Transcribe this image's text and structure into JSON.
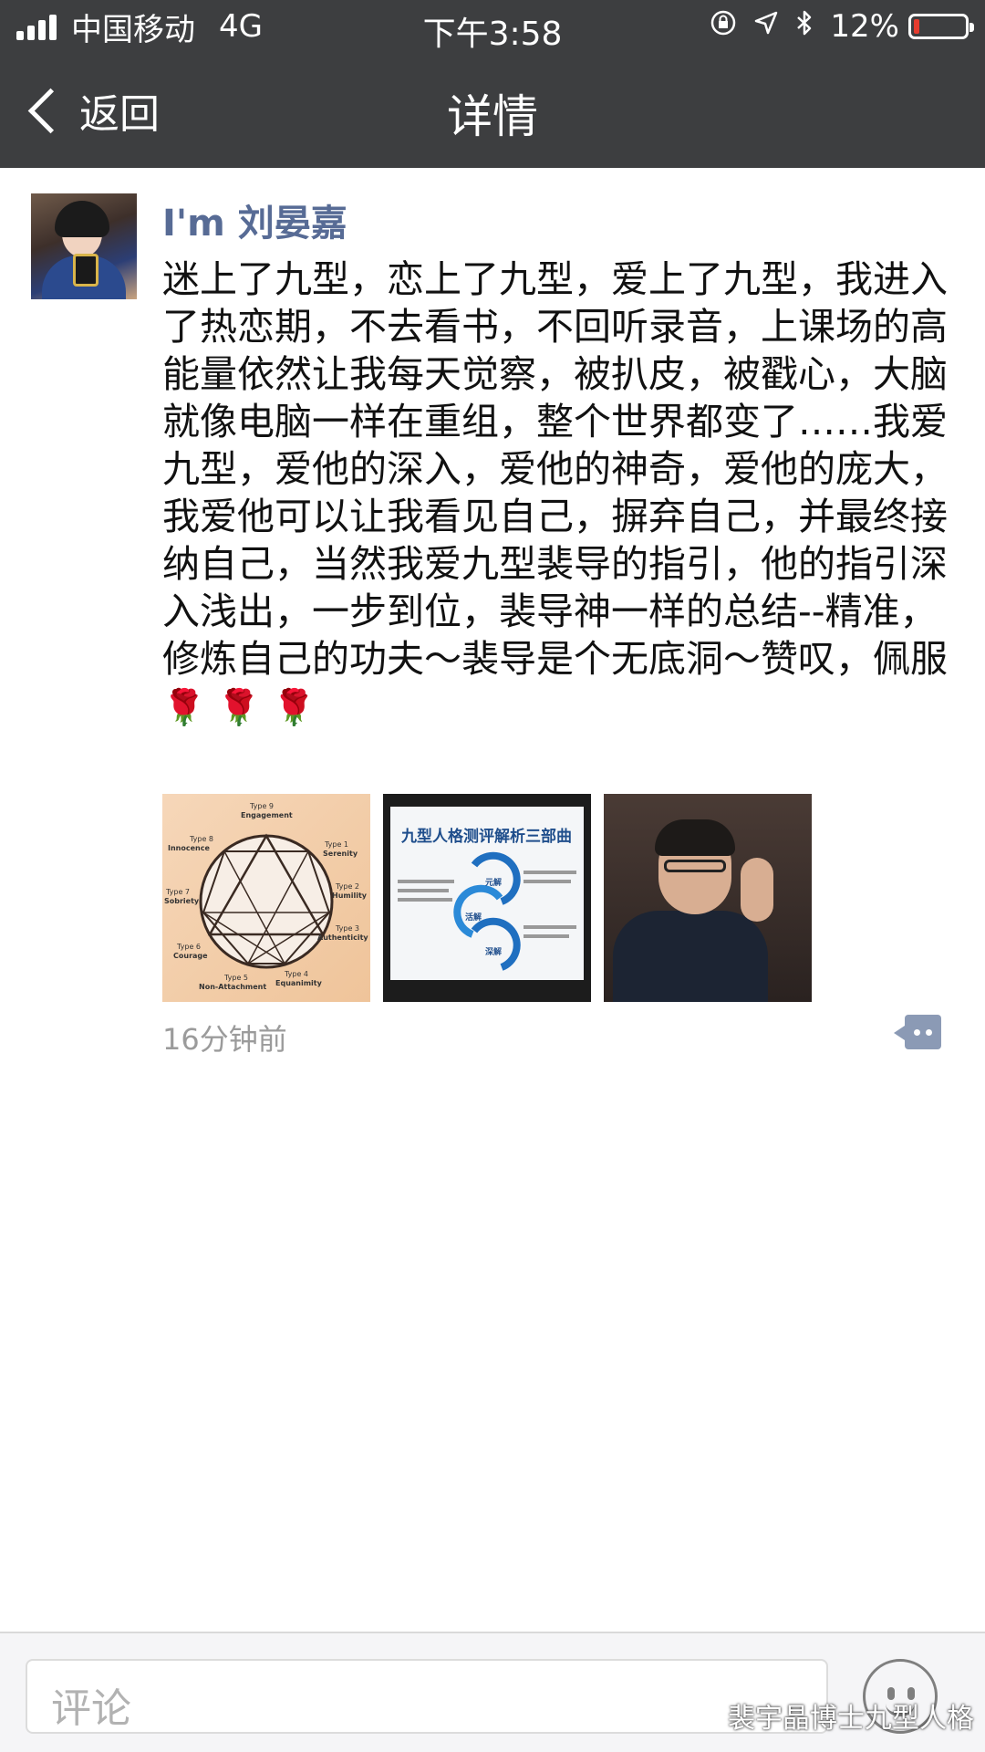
{
  "status_bar": {
    "carrier": "中国移动",
    "network": "4G",
    "time": "下午3:58",
    "battery": "12%",
    "battery_level": 0.12,
    "icons": [
      "orientation-lock-icon",
      "location-icon",
      "bluetooth-icon"
    ]
  },
  "nav": {
    "back_label": "返回",
    "title": "详情"
  },
  "post": {
    "author": "I'm 刘晏嘉",
    "text": "迷上了九型，恋上了九型，爱上了九型，我进入了热恋期，不去看书，不回听录音，上课场的高能量依然让我每天觉察，被扒皮，被戳心，大脑就像电脑一样在重组，整个世界都变了……我爱九型，爱他的深入，爱他的神奇，爱他的庞大，我爱他可以让我看见自己，摒弃自己，并最终接纳自己，当然我爱九型裴导的指引，他的指引深入浅出，一步到位，裴导神一样的总结--精准，修炼自己的功夫～裴导是个无底洞～赞叹，佩服",
    "emoji": [
      "🌹",
      "🌹",
      "🌹"
    ],
    "images": [
      {
        "name": "enneagram-diagram",
        "labels": [
          "Type 9",
          "Engagement",
          "Type 8",
          "Innocence",
          "Type 1",
          "Serenity",
          "Type 7",
          "Sobriety",
          "Type 2",
          "Humility",
          "Type 3",
          "Authenticity",
          "Type 6",
          "Courage",
          "Type 5",
          "Non-Attachment",
          "Type 4",
          "Equanimity"
        ]
      },
      {
        "name": "slide-photo",
        "title": "九型人格测评解析三部曲",
        "steps": [
          "元解",
          "活解",
          "深解"
        ]
      },
      {
        "name": "speaker-photo"
      }
    ],
    "time": "16分钟前"
  },
  "bottom_bar": {
    "comment_placeholder": "评论"
  },
  "watermark": "裴宇晶博士九型人格",
  "colors": {
    "nav_bg": "#3d3e40",
    "author_name": "#576b95",
    "battery_low": "#e63c2e",
    "comment_icon": "#8b9ab5"
  }
}
